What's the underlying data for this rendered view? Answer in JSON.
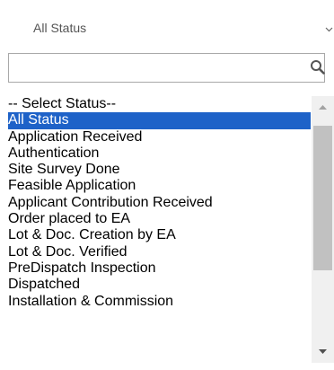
{
  "status_select": {
    "value": "All Status"
  },
  "search": {
    "value": "",
    "placeholder": ""
  },
  "options": [
    "-- Select Status--",
    "All Status",
    "Application Received",
    "Authentication",
    "Site Survey Done",
    "Feasible Application",
    "Applicant Contribution Received",
    "Order placed to EA",
    "Lot & Doc. Creation by EA",
    "Lot & Doc. Verified",
    "PreDispatch Inspection",
    "Dispatched",
    "Installation & Commission"
  ],
  "selected_option": "All Status",
  "colors": {
    "selection": "#1e62c8",
    "scrollbar_track": "#f0f0f0",
    "scrollbar_thumb": "#c1c1c1",
    "border": "#a9a9a9"
  },
  "icons": {
    "dropdown": "chevron-down-icon",
    "search": "search-icon",
    "scroll_up": "scroll-up-arrow-icon",
    "scroll_down": "scroll-down-arrow-icon"
  }
}
